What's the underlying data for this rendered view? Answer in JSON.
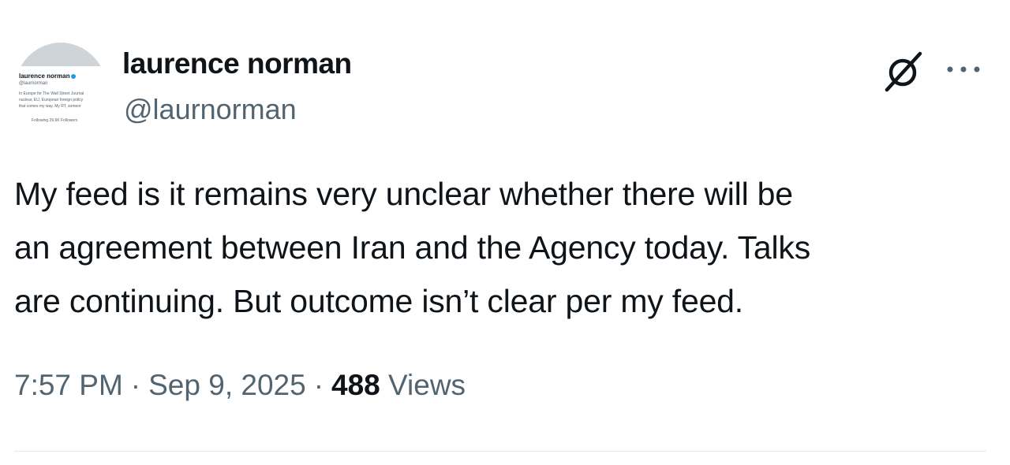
{
  "author": {
    "display_name": "laurence norman",
    "handle": "@laurnorman",
    "avatar_mini": {
      "name": "laurence norman",
      "handle": "@laurnorman",
      "bio_line1": "In Europe for The Wall Street Journal",
      "bio_line2": "nuclear, EU, European foreign policy",
      "bio_line3": "that comes my way. My RT, someor",
      "stats": "Following 29.6K Followers"
    }
  },
  "icons": {
    "grok": "grok-icon",
    "more": "more-icon"
  },
  "tweet": {
    "text": "My feed is it remains very unclear whether there will be\nan agreement between Iran and the Agency today. Talks\nare continuing. But outcome isn’t clear per my feed.",
    "time": "7:57 PM",
    "date": "Sep 9, 2025",
    "separator": "·",
    "views_count": "488",
    "views_label": "Views"
  },
  "colors": {
    "text": "#0f1419",
    "secondary": "#536471",
    "verified": "#1d9bf0"
  }
}
